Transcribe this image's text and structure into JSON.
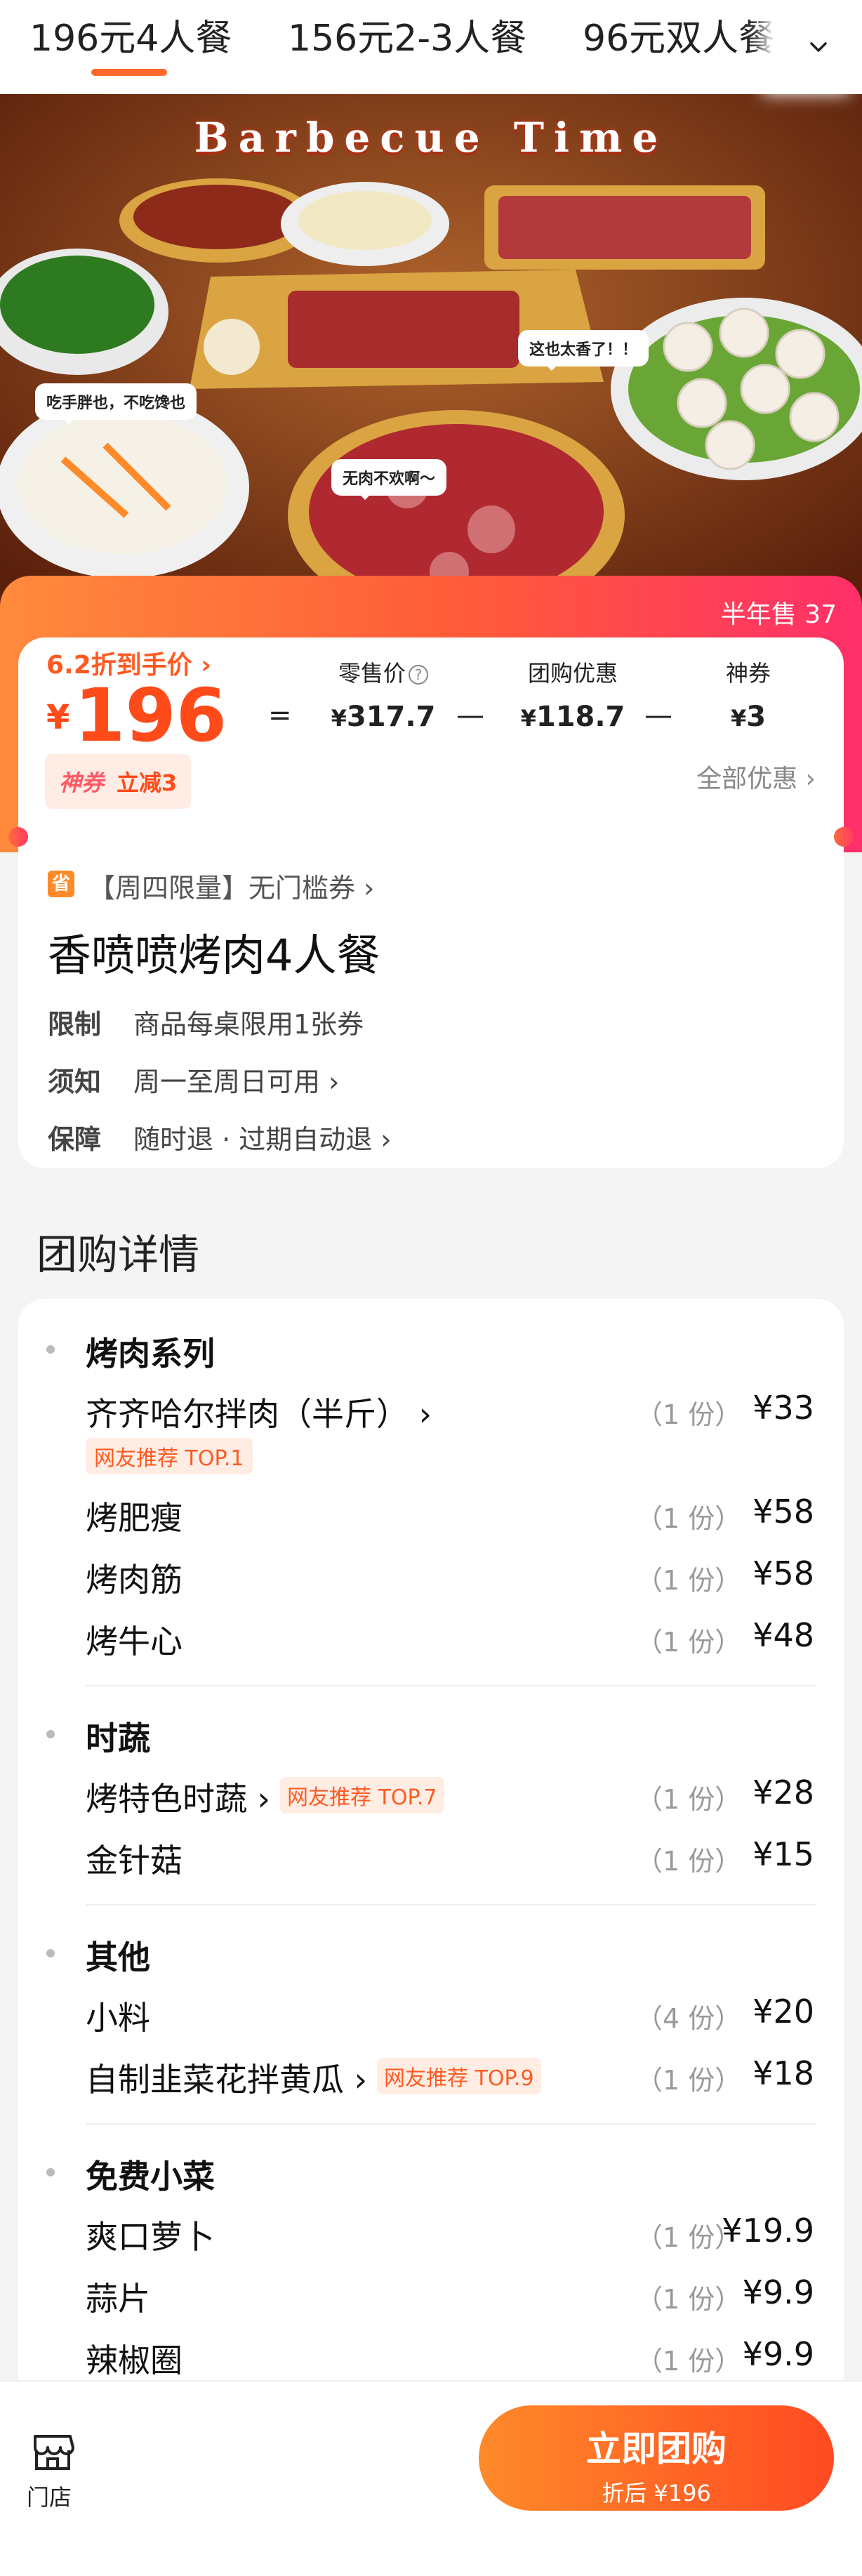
{
  "tabs": [
    {
      "label": "196元4人餐",
      "active": true
    },
    {
      "label": "156元2-3人餐",
      "active": false
    },
    {
      "label": "96元双人餐",
      "active": false
    }
  ],
  "hero": {
    "title": "Barbecue Time",
    "bubbles": [
      "吃手胖也，不吃馋也",
      "这也太香了！！",
      "无肉不欢啊～"
    ]
  },
  "price": {
    "sold": "半年售 37",
    "discount": "6.2折到手价 ›",
    "currency": "¥",
    "amount": "196",
    "eq": "=",
    "minus": "—",
    "retail_label": "零售价",
    "retail_value": "317.7",
    "group_label": "团购优惠",
    "group_value": "118.7",
    "coupon_label": "神券",
    "coupon_value": "3",
    "yen": "¥",
    "coupon_tag": "神券",
    "coupon_tag_text": "立减3",
    "all_offers": "全部优惠 ›"
  },
  "info": {
    "sheng": "省",
    "limit": "【周四限量】无门槛券 ›",
    "title": "香喷喷烤肉4人餐",
    "rows": [
      {
        "k": "限制",
        "v": "商品每桌限用1张券"
      },
      {
        "k": "须知",
        "v": "周一至周日可用 ›"
      },
      {
        "k": "保障",
        "v": "随时退 · 过期自动退 ›"
      }
    ]
  },
  "detail": {
    "heading": "团购详情",
    "groups": [
      {
        "title": "烤肉系列",
        "items": [
          {
            "name": "齐齐哈尔拌肉（半斤） ›",
            "qty": "（1 份）",
            "price": "¥33",
            "tag": "网友推荐 TOP.1"
          },
          {
            "name": "烤肥瘦",
            "qty": "（1 份）",
            "price": "¥58"
          },
          {
            "name": "烤肉筋",
            "qty": "（1 份）",
            "price": "¥58"
          },
          {
            "name": "烤牛心",
            "qty": "（1 份）",
            "price": "¥48"
          }
        ]
      },
      {
        "title": "时蔬",
        "items": [
          {
            "name": "烤特色时蔬 ›",
            "qty": "（1 份）",
            "price": "¥28",
            "tag": "网友推荐 TOP.7"
          },
          {
            "name": "金针菇",
            "qty": "（1 份）",
            "price": "¥15"
          }
        ]
      },
      {
        "title": "其他",
        "items": [
          {
            "name": "小料",
            "qty": "（4 份）",
            "price": "¥20"
          },
          {
            "name": "自制韭菜花拌黄瓜 ›",
            "qty": "（1 份）",
            "price": "¥18",
            "tag": "网友推荐 TOP.9"
          }
        ]
      },
      {
        "title": "免费小菜",
        "items": [
          {
            "name": "爽口萝卜",
            "qty": "（1 份）",
            "price": "¥19.9"
          },
          {
            "name": "蒜片",
            "qty": "（1 份）",
            "price": "¥9.9"
          },
          {
            "name": "辣椒圈",
            "qty": "（1 份）",
            "price": "¥9.9"
          }
        ]
      }
    ]
  },
  "bottom": {
    "store_label": "门店",
    "buy_label": "立即团购",
    "buy_sub": "折后 ¥196"
  },
  "colors": {
    "accent": "#ff5a22",
    "gradient_start": "#ff8a3c",
    "gradient_end": "#ff2f6a"
  }
}
